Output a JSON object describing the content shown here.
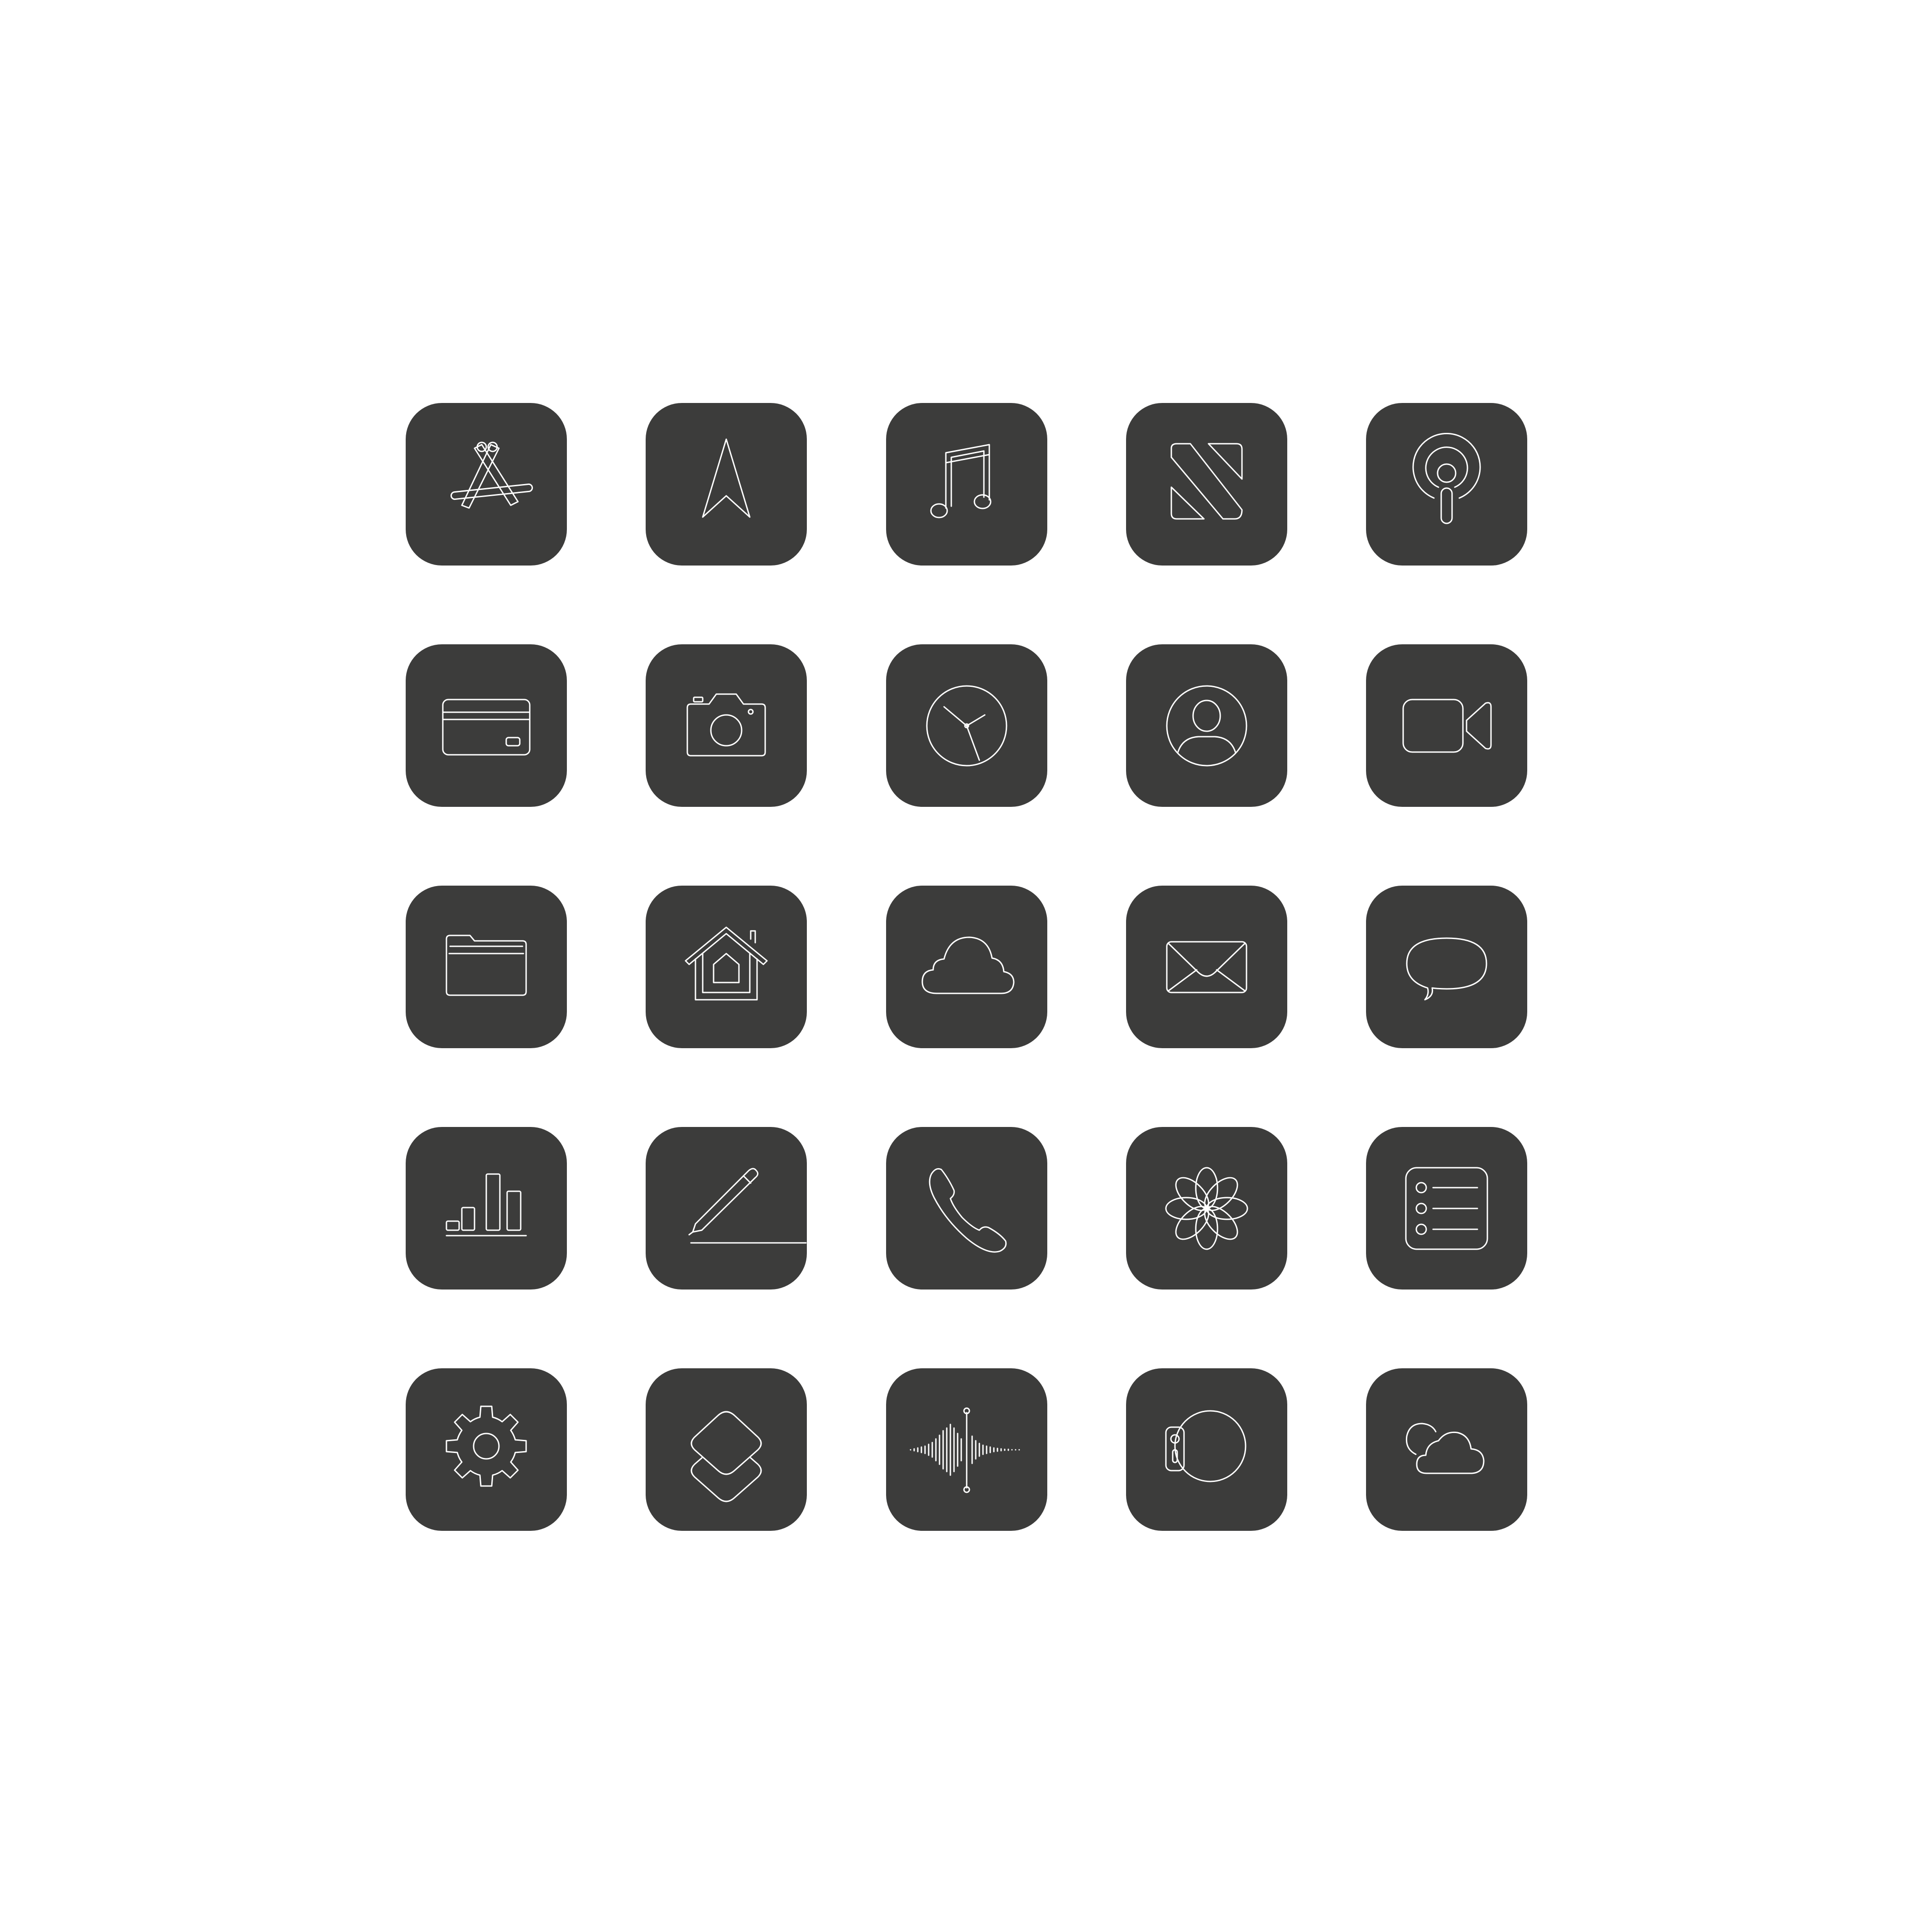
{
  "colors": {
    "page_background": "#ffffff",
    "tile": "#3c3c3b",
    "glyph_stroke": "#ffffff"
  },
  "icons": [
    {
      "name": "app-store-icon"
    },
    {
      "name": "maps-navigation-icon"
    },
    {
      "name": "music-icon"
    },
    {
      "name": "news-icon"
    },
    {
      "name": "podcasts-icon"
    },
    {
      "name": "wallet-card-icon"
    },
    {
      "name": "camera-icon"
    },
    {
      "name": "clock-icon"
    },
    {
      "name": "contacts-icon"
    },
    {
      "name": "facetime-icon"
    },
    {
      "name": "files-folder-icon"
    },
    {
      "name": "home-icon"
    },
    {
      "name": "icloud-icon"
    },
    {
      "name": "mail-icon"
    },
    {
      "name": "messages-icon"
    },
    {
      "name": "numbers-chart-icon"
    },
    {
      "name": "pages-pencil-icon"
    },
    {
      "name": "phone-icon"
    },
    {
      "name": "photos-icon"
    },
    {
      "name": "reminders-icon"
    },
    {
      "name": "settings-gear-icon"
    },
    {
      "name": "shortcuts-icon"
    },
    {
      "name": "voice-memos-icon"
    },
    {
      "name": "watch-icon"
    },
    {
      "name": "weather-icon"
    }
  ]
}
